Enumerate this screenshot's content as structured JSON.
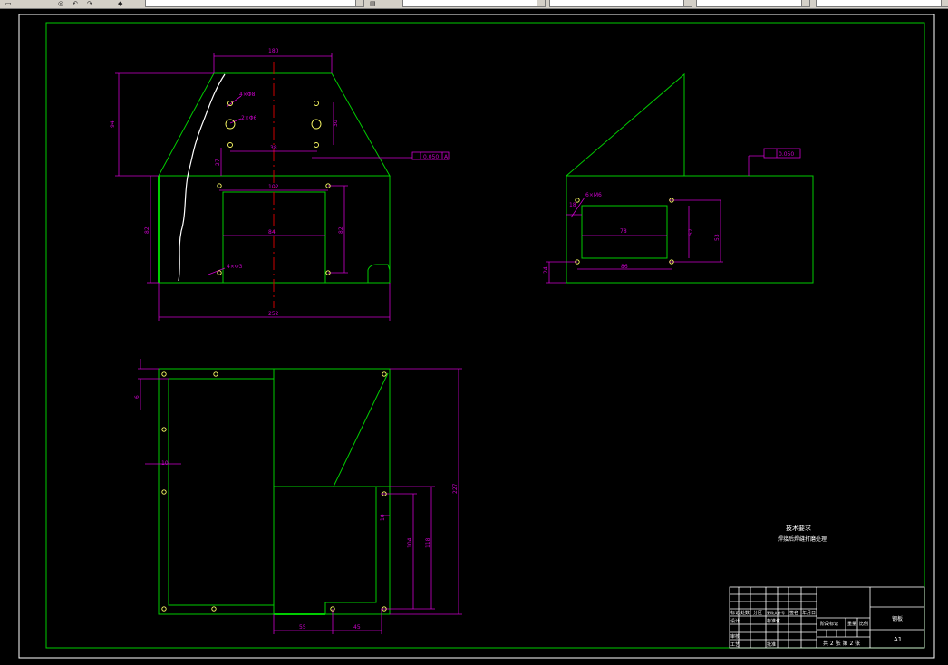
{
  "toolbar": {
    "icons": [
      "pan-icon",
      "zoom-icon",
      "undo-icon",
      "redo-icon",
      "layer-icon"
    ]
  },
  "drawing": {
    "front_view": {
      "dim_top": "180",
      "dim_height": "94",
      "hole_note_1": "4×Φ8",
      "hole_note_2": "2×Φ6",
      "dim_hole_vertical": "30",
      "dim_hole_spacing": "38",
      "dim_small_vertical": "27",
      "tolerance_frame": "0.050",
      "datum_label": "A",
      "dim_inner_top": "102",
      "dim_inner_middle": "84",
      "dim_inner_height": "82",
      "dim_left_height": "82",
      "hole_note_3": "4×Φ3",
      "dim_bottom": "252"
    },
    "side_view": {
      "flatness_value": "0.050",
      "hole_note": "6×M6",
      "dim_small": "18",
      "dim_inner_width": "78",
      "dim_inner_height": "57",
      "dim_outer_height": "53",
      "dim_bottom_width": "86",
      "dim_left": "24"
    },
    "top_view": {
      "dim_left_top": "6",
      "dim_left_mid": "10",
      "dim_total_height": "227",
      "dim_inner_a": "104",
      "dim_inner_b": "118",
      "dim_small_right": "10",
      "dim_bottom_a": "55",
      "dim_bottom_b": "45"
    },
    "tech_notes": {
      "title": "技术要求",
      "line1": "焊接后焊缝打磨处理"
    },
    "title_block": {
      "material": "钢板",
      "scale": "A1",
      "sheet": "共 2 张  第 2 张",
      "label_design": "设计",
      "label_check": "审核",
      "label_process": "工艺",
      "label_standard": "标准化",
      "label_approve": "批准",
      "col_mark": "标记",
      "col_count": "处数",
      "col_zone": "分区",
      "col_change": "更改文件号",
      "col_sign": "签名",
      "col_date": "年月日",
      "col_stage": "阶段标记",
      "col_weight": "重量",
      "col_ratio": "比例"
    }
  },
  "colors": {
    "outline": "#00cc00",
    "dimension": "#cc00cc",
    "text": "#ffffff",
    "centerline": "#cc0000",
    "hole": "#ffff66"
  }
}
